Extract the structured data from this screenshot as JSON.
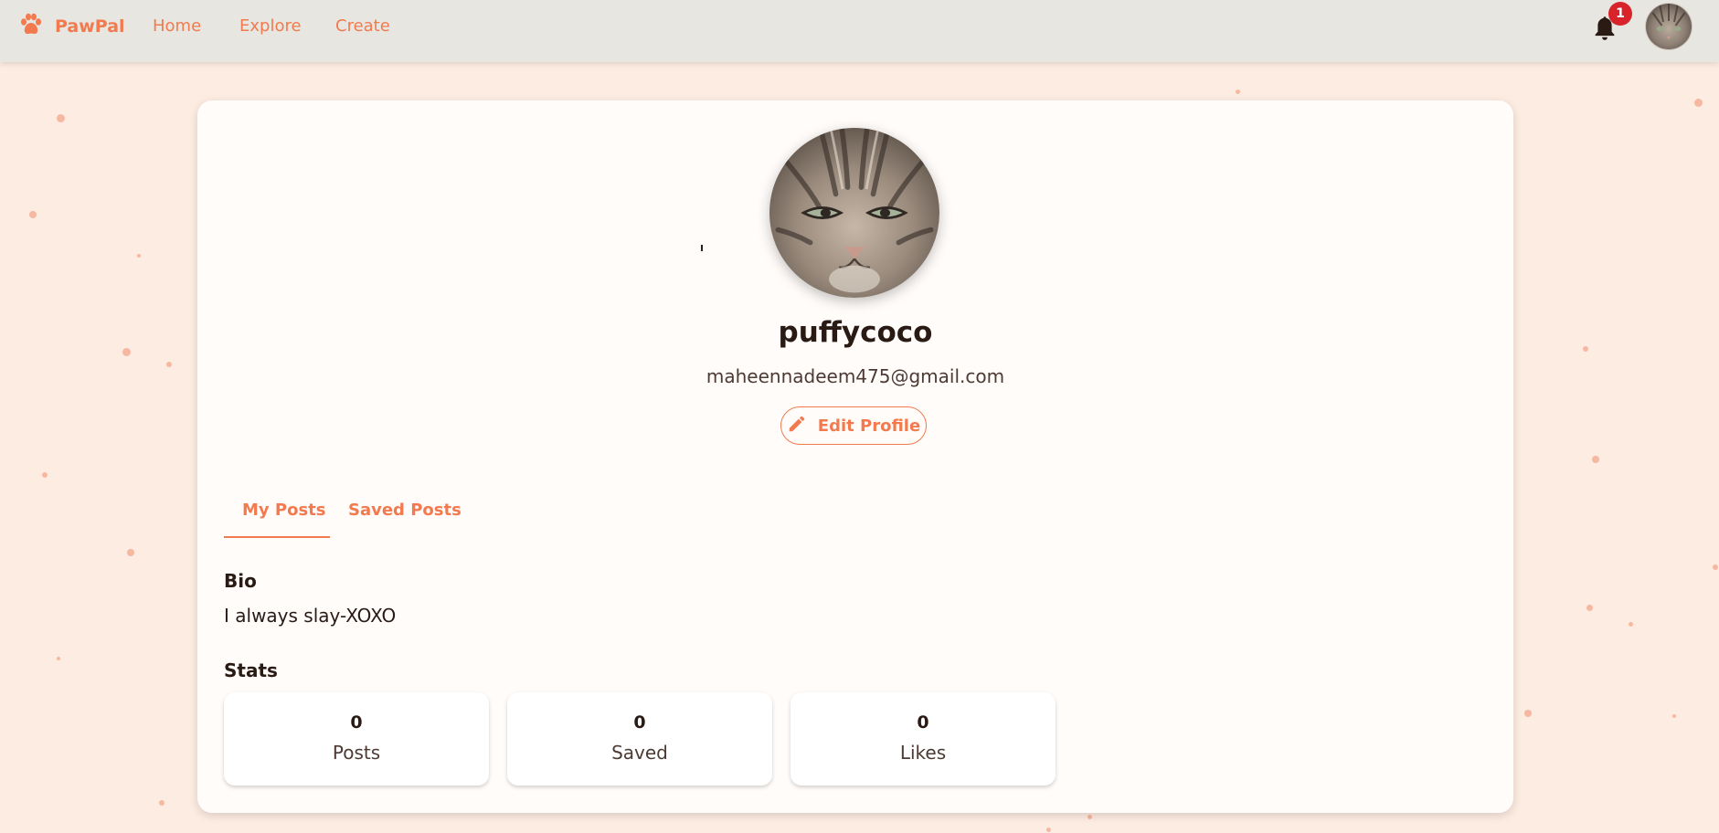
{
  "colors": {
    "accent": "#f27a4e",
    "page_background": "#fdece2",
    "topbar_background": "#e7e6e1",
    "badge": "#d8232b"
  },
  "nav": {
    "brand": "PawPal",
    "brand_icon": "paw-icon",
    "links": [
      "Home",
      "Explore",
      "Create"
    ],
    "notification_icon": "bell-icon",
    "notification_count": "1"
  },
  "profile": {
    "username": "puffycoco",
    "email": "maheennadeem475@gmail.com",
    "edit_button_label": "Edit Profile",
    "edit_icon": "pencil-icon"
  },
  "tabs": {
    "active": "My Posts",
    "items": [
      "My Posts",
      "Saved Posts"
    ]
  },
  "bio": {
    "heading": "Bio",
    "text": "I always slay-XOXO"
  },
  "stats": {
    "heading": "Stats",
    "items": [
      {
        "value": "0",
        "label": "Posts"
      },
      {
        "value": "0",
        "label": "Saved"
      },
      {
        "value": "0",
        "label": "Likes"
      }
    ]
  }
}
